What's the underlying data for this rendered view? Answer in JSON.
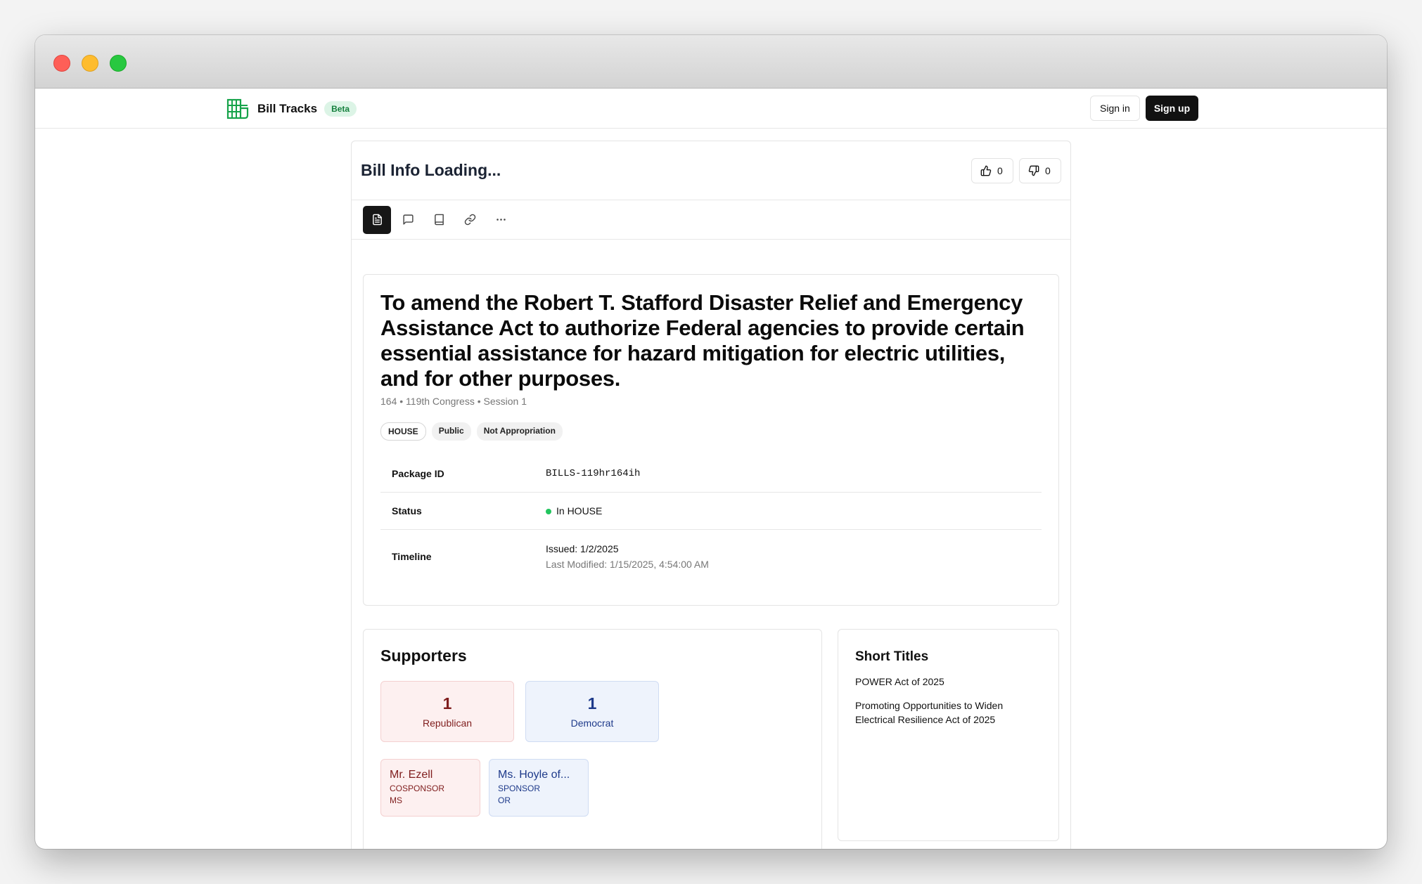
{
  "navbar": {
    "brand_name": "Bill Tracks",
    "beta_label": "Beta",
    "signin_label": "Sign in",
    "signup_label": "Sign up"
  },
  "header": {
    "title": "Bill Info Loading...",
    "upvotes": "0",
    "downvotes": "0"
  },
  "toolbar": {
    "icons": [
      "document-icon",
      "comment-icon",
      "book-icon",
      "link-icon",
      "more-icon"
    ]
  },
  "bill": {
    "title": "To amend the Robert T. Stafford Disaster Relief and Emergency Assistance Act to authorize Federal agencies to provide certain essential assistance for hazard mitigation for electric utilities, and for other purposes.",
    "meta": "164 • 119th Congress • Session 1",
    "tags": [
      "HOUSE",
      "Public",
      "Not Appropriation"
    ],
    "package_id_label": "Package ID",
    "package_id": "BILLS-119hr164ih",
    "status_label": "Status",
    "status": "In HOUSE",
    "timeline_label": "Timeline",
    "issued": "Issued: 1/2/2025",
    "last_modified": "Last Modified: 1/15/2025, 4:54:00 AM"
  },
  "supporters": {
    "title": "Supporters",
    "republican_count": "1",
    "republican_label": "Republican",
    "democrat_count": "1",
    "democrat_label": "Democrat",
    "members": [
      {
        "name": "Mr. Ezell",
        "role": "COSPONSOR",
        "state": "MS",
        "party": "rep"
      },
      {
        "name": "Ms. Hoyle of...",
        "role": "SPONSOR",
        "state": "OR",
        "party": "dem"
      }
    ]
  },
  "short_titles": {
    "title": "Short Titles",
    "items": [
      "POWER Act of 2025",
      "Promoting Opportunities to Widen Electrical Resilience Act of 2025"
    ]
  },
  "colors": {
    "accent_green": "#15803d",
    "republican": "#7f1d1d",
    "democrat": "#1e3a8a",
    "status_dot": "#22c55e"
  }
}
